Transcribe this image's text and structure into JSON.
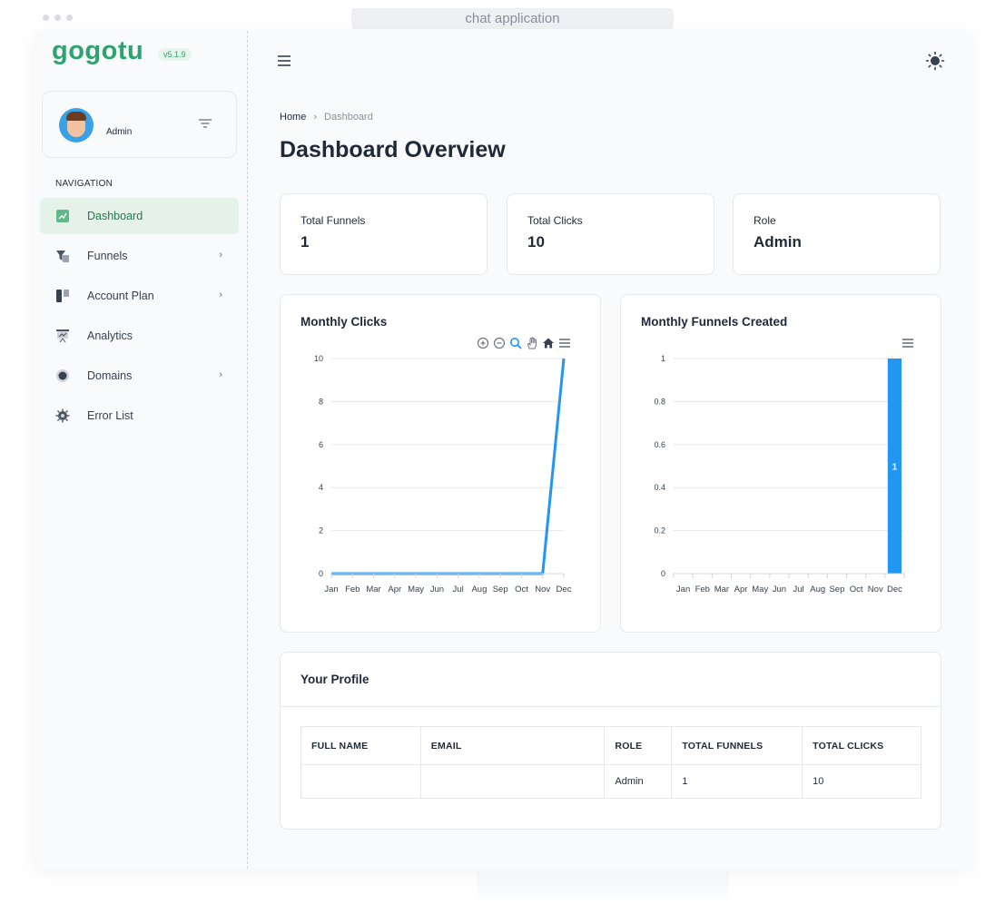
{
  "window": {
    "url_label": "chat application"
  },
  "brand": {
    "name": "gogotu",
    "version": "v5.1.9"
  },
  "user": {
    "name": "Admin"
  },
  "nav": {
    "heading": "NAVIGATION",
    "items": [
      {
        "label": "Dashboard",
        "icon": "chart-icon",
        "active": true,
        "has_children": false
      },
      {
        "label": "Funnels",
        "icon": "funnel-icon",
        "active": false,
        "has_children": true
      },
      {
        "label": "Account Plan",
        "icon": "plan-icon",
        "active": false,
        "has_children": true
      },
      {
        "label": "Analytics",
        "icon": "presentation-icon",
        "active": false,
        "has_children": false
      },
      {
        "label": "Domains",
        "icon": "globe-icon",
        "active": false,
        "has_children": true
      },
      {
        "label": "Error List",
        "icon": "bug-icon",
        "active": false,
        "has_children": false
      }
    ]
  },
  "breadcrumb": {
    "home": "Home",
    "current": "Dashboard"
  },
  "page": {
    "title": "Dashboard Overview"
  },
  "stats": [
    {
      "label": "Total Funnels",
      "value": "1"
    },
    {
      "label": "Total Clicks",
      "value": "10"
    },
    {
      "label": "Role",
      "value": "Admin"
    }
  ],
  "colors": {
    "accent": "#2ea26f",
    "chart": "#2196f3",
    "active_bg": "#e4f2ea"
  },
  "chart_data": [
    {
      "type": "line",
      "title": "Monthly Clicks",
      "categories": [
        "Jan",
        "Feb",
        "Mar",
        "Apr",
        "May",
        "Jun",
        "Jul",
        "Aug",
        "Sep",
        "Oct",
        "Nov",
        "Dec"
      ],
      "series": [
        {
          "values": [
            0,
            0,
            0,
            0,
            0,
            0,
            0,
            0,
            0,
            0,
            0,
            10
          ]
        }
      ],
      "yticks": [
        "0",
        "2",
        "4",
        "6",
        "8",
        "10"
      ],
      "ylim": [
        0,
        10
      ],
      "grid": true
    },
    {
      "type": "bar",
      "title": "Monthly Funnels Created",
      "categories": [
        "Jan",
        "Feb",
        "Mar",
        "Apr",
        "May",
        "Jun",
        "Jul",
        "Aug",
        "Sep",
        "Oct",
        "Nov",
        "Dec"
      ],
      "series": [
        {
          "values": [
            0,
            0,
            0,
            0,
            0,
            0,
            0,
            0,
            0,
            0,
            0,
            1
          ]
        }
      ],
      "yticks": [
        "0",
        "0.2",
        "0.4",
        "0.6",
        "0.8",
        "1"
      ],
      "ylim": [
        0,
        1
      ],
      "data_labels": true,
      "grid": true
    }
  ],
  "profile": {
    "title": "Your Profile",
    "columns": [
      "FULL NAME",
      "EMAIL",
      "ROLE",
      "TOTAL FUNNELS",
      "TOTAL CLICKS"
    ],
    "rows": [
      [
        "",
        "",
        "Admin",
        "1",
        "10"
      ]
    ]
  }
}
